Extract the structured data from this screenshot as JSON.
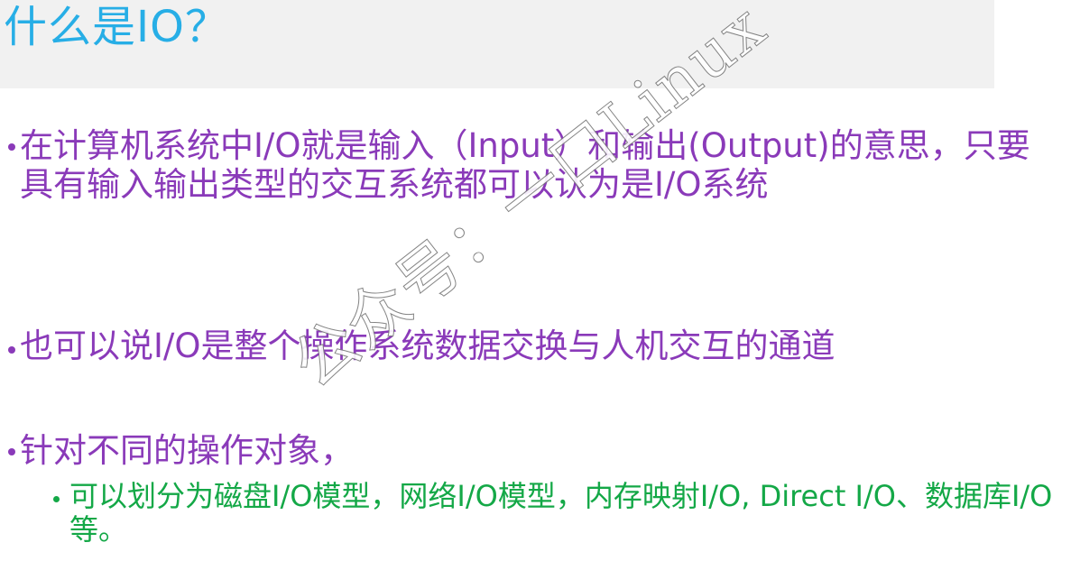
{
  "slide": {
    "title": "什么是IO？",
    "bullets": [
      {
        "level": 1,
        "text": "在计算机系统中I/O就是输入（Input）和输出(Output)的意思，只要具有输入输出类型的交互系统都可以认为是I/O系统"
      },
      {
        "level": 1,
        "text": "也可以说I/O是整个操作系统数据交换与人机交互的通道"
      },
      {
        "level": 1,
        "text": "针对不同的操作对象，"
      },
      {
        "level": 2,
        "text": "可以划分为磁盘I/O模型，网络I/O模型，内存映射I/O, Direct I/O、数据库I/O等。"
      }
    ],
    "watermark": "公众号：一口Linux"
  },
  "colors": {
    "title": "#27aee6",
    "level1_text": "#8a3ab9",
    "level2_text": "#14a847",
    "title_background": "#f1f1f1"
  }
}
